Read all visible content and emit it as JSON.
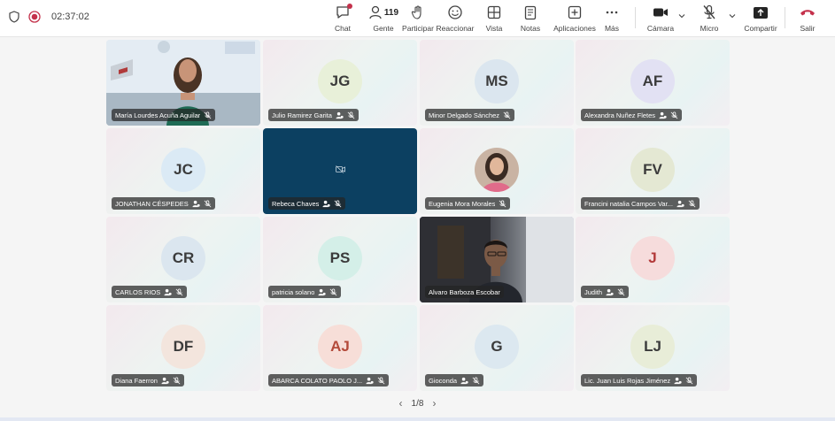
{
  "call": {
    "timer": "02:37:02"
  },
  "toolbar": {
    "chat": "Chat",
    "people": "Gente",
    "people_count": "119",
    "raise": "Participar",
    "react": "Reaccionar",
    "view": "Vista",
    "notes": "Notas",
    "apps": "Aplicaciones",
    "more": "Más",
    "camera": "Cámara",
    "mic": "Micro",
    "share": "Compartir",
    "leave": "Salir"
  },
  "participants": [
    {
      "name": "María Lourdes Acuña Aguilar",
      "initials": "",
      "video": true
    },
    {
      "name": "Julio Ramirez Garita",
      "initials": "JG",
      "avatar_color": "#e8f0d9"
    },
    {
      "name": "Minor Delgado Sánchez",
      "initials": "MS",
      "avatar_color": "#dbe6ef"
    },
    {
      "name": "Alexandra Nuñez Fletes",
      "initials": "AF",
      "avatar_color": "#e2e1f3"
    },
    {
      "name": "JONATHAN CÉSPEDES",
      "initials": "JC",
      "avatar_color": "#dbeaf5"
    },
    {
      "name": "Rebeca Chaves",
      "initials": "",
      "camera_off": true
    },
    {
      "name": "Eugenia Mora Morales",
      "initials": "",
      "photo_avatar": true
    },
    {
      "name": "Francini natalia Campos Var...",
      "initials": "FV",
      "avatar_color": "#e4e8d3"
    },
    {
      "name": "CARLOS RIOS",
      "initials": "CR",
      "avatar_color": "#dbe6ef"
    },
    {
      "name": "patricia solano",
      "initials": "PS",
      "avatar_color": "#d4efe8"
    },
    {
      "name": "Alvaro Barboza Escobar",
      "initials": "",
      "video": true,
      "speaking": true
    },
    {
      "name": "Judith",
      "initials": "J",
      "avatar_color": "#f6dcdc"
    },
    {
      "name": "Diana Faerron",
      "initials": "DF",
      "avatar_color": "#f3e5dd"
    },
    {
      "name": "ABARCA COLATO PAOLO J...",
      "initials": "AJ",
      "avatar_color": "#f7ded8"
    },
    {
      "name": "Gioconda",
      "initials": "G",
      "avatar_color": "#dce8f0"
    },
    {
      "name": "Lic. Juan Luis Rojas Jiménez",
      "initials": "LJ",
      "avatar_color": "#e8edd8"
    }
  ],
  "pager": {
    "label": "1/8"
  }
}
